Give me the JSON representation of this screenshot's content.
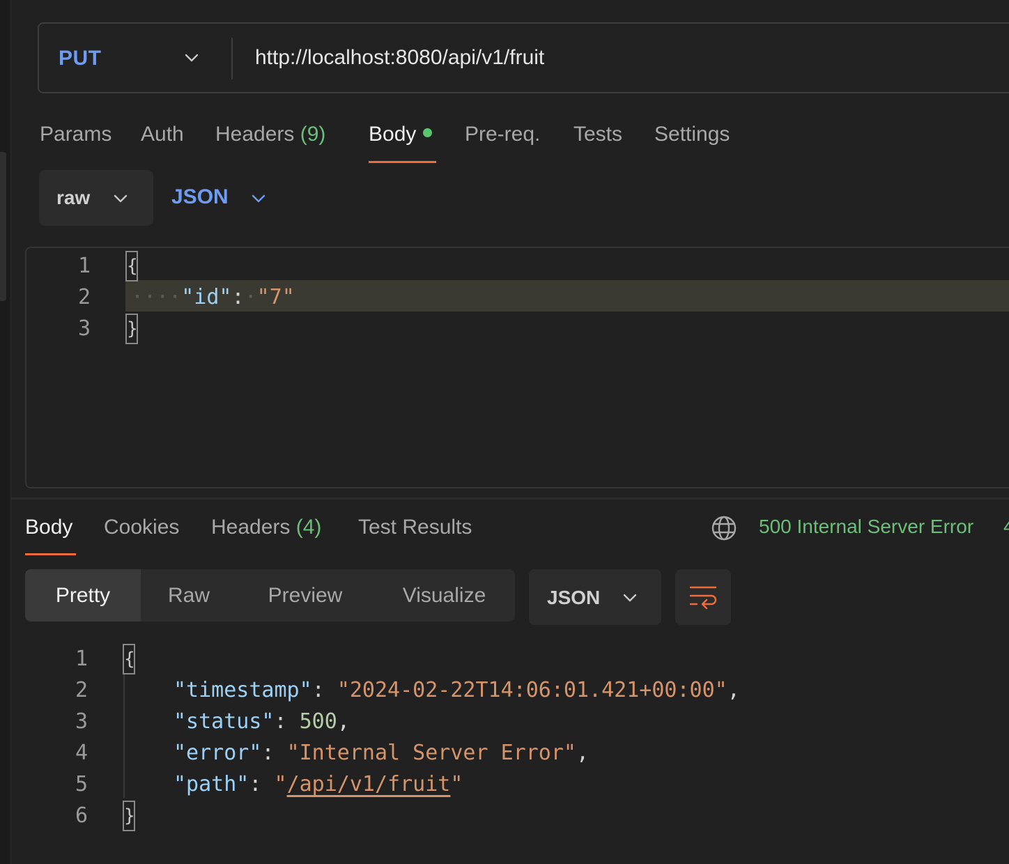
{
  "request": {
    "method": "PUT",
    "url": "http://localhost:8080/api/v1/fruit",
    "tabs": [
      {
        "label": "Params"
      },
      {
        "label": "Auth"
      },
      {
        "label": "Headers",
        "count": "(9)"
      },
      {
        "label": "Body",
        "active": true,
        "modified": true
      },
      {
        "label": "Pre-req."
      },
      {
        "label": "Tests"
      },
      {
        "label": "Settings"
      }
    ],
    "body_mode": "raw",
    "body_language": "JSON",
    "body_lines": [
      {
        "n": "1",
        "text": "{"
      },
      {
        "n": "2",
        "key": "\"id\"",
        "value": "\"7\""
      },
      {
        "n": "3",
        "text": "}"
      }
    ]
  },
  "response": {
    "tabs": [
      {
        "label": "Body",
        "active": true
      },
      {
        "label": "Cookies"
      },
      {
        "label": "Headers",
        "count": "(4)"
      },
      {
        "label": "Test Results"
      }
    ],
    "status": "500 Internal Server Error",
    "status_overflow": "4",
    "view_modes": [
      "Pretty",
      "Raw",
      "Preview",
      "Visualize"
    ],
    "active_view_mode": "Pretty",
    "language": "JSON",
    "lines": [
      {
        "n": "1",
        "text": "{"
      },
      {
        "n": "2",
        "key": "\"timestamp\"",
        "value": "\"2024-02-22T14:06:01.421+00:00\"",
        "trail": ","
      },
      {
        "n": "3",
        "key": "\"status\"",
        "value": "500",
        "trail": ","
      },
      {
        "n": "4",
        "key": "\"error\"",
        "value": "\"Internal Server Error\"",
        "trail": ","
      },
      {
        "n": "5",
        "key": "\"path\"",
        "value_open": "\"",
        "value_link": "/api/v1/fruit",
        "value_close": "\""
      },
      {
        "n": "6",
        "text": "}"
      }
    ]
  },
  "colors": {
    "accent": "#f26b3a",
    "method": "#6f9bf0",
    "success_green": "#6bbf78",
    "json_key": "#9cd1f5",
    "json_string": "#d6946b",
    "json_number": "#b5cea8"
  }
}
